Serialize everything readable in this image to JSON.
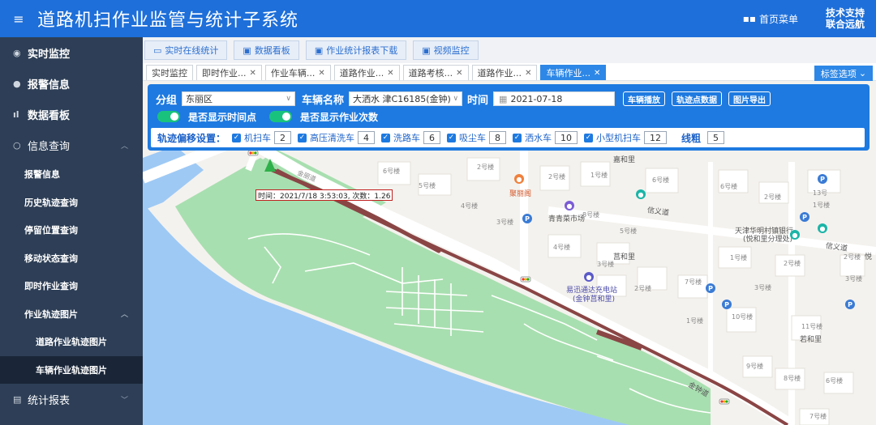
{
  "header": {
    "title": "道路机扫作业监管与统计子系统",
    "home_menu": "首页菜单",
    "support_line1": "技术支持",
    "support_line2": "联合远航"
  },
  "sidebar": {
    "items": [
      {
        "label": "实时监控",
        "icon": "location-icon"
      },
      {
        "label": "报警信息",
        "icon": "alarm-icon"
      },
      {
        "label": "数据看板",
        "icon": "bar-chart-icon"
      },
      {
        "label": "信息查询",
        "icon": "search-icon"
      }
    ],
    "sub_items": [
      "报警信息",
      "历史轨迹查询",
      "停留位置查询",
      "移动状态查询",
      "即时作业查询",
      "作业轨迹图片"
    ],
    "sub2_items": [
      "道路作业轨迹图片",
      "车辆作业轨迹图片"
    ],
    "last_item": "统计报表"
  },
  "buttons": {
    "realtime": "实时在线统计",
    "dashboard": "数据看板",
    "report_download": "作业统计报表下载",
    "video": "视频监控"
  },
  "tabs": {
    "items": [
      "实时监控",
      "即时作业...",
      "作业车辆...",
      "道路作业...",
      "道路考核...",
      "道路作业...",
      "车辆作业..."
    ],
    "active_index": 6,
    "options_label": "标签选项"
  },
  "filters": {
    "group_label": "分组",
    "group_value": "东丽区",
    "vehicle_label": "车辆名称",
    "vehicle_value": "大洒水 津C16185(金钟)",
    "time_label": "时间",
    "date_value": "2021-07-18",
    "btn_play": "车辆播放",
    "btn_track_data": "轨迹点数据",
    "btn_export": "图片导出",
    "toggle_time": "是否显示时间点",
    "toggle_count": "是否显示作业次数"
  },
  "offset": {
    "title": "轨迹偏移设置：",
    "items": [
      {
        "label": "机扫车",
        "value": "2"
      },
      {
        "label": "高压清洗车",
        "value": "4"
      },
      {
        "label": "洗路车",
        "value": "6"
      },
      {
        "label": "吸尘车",
        "value": "8"
      },
      {
        "label": "洒水车",
        "value": "10"
      },
      {
        "label": "小型机扫车",
        "value": "12"
      }
    ],
    "line_width_label": "线粗",
    "line_width_value": "5"
  },
  "map": {
    "tooltip": "时间：2021/7/18 3:53:03, 次数：1.26",
    "labels": {
      "road1": "金丽道",
      "road2": "信义道",
      "road3": "信义道",
      "road4": "金钟道",
      "b6": "6号楼",
      "b5": "5号楼",
      "b2a": "2号楼",
      "b4": "4号楼",
      "b3": "3号楼",
      "b2b": "2号楼",
      "b1": "1号楼",
      "b6b": "6号楼",
      "b5b": "5号楼",
      "b4b": "4号楼",
      "b3b": "3号楼",
      "b2c": "2号楼",
      "b7": "7号楼",
      "b1b": "1号楼",
      "b10": "10号楼",
      "b11": "11号楼",
      "b9": "9号楼",
      "b8": "8号楼",
      "b6c": "6号楼",
      "b7b": "7号楼",
      "b3c": "3号楼",
      "b2d": "2号楼",
      "b1c": "1号楼",
      "b13": "13号",
      "b2e": "2号楼",
      "b6d": "6号楼",
      "b1d": "1号楼",
      "b2f": "2号楼",
      "b3d": "3号楼",
      "b8b": "8号楼",
      "market": "青青菜市场",
      "restaurant": "聚丽阁",
      "community": "莒和里",
      "community2": "嘉和里",
      "community3": "若和里",
      "charging1": "易迅通达充电站",
      "charging2": "(金钟莒和里)",
      "bank1": "天津华明村镇银行",
      "bank2": "(悦和里分理处)",
      "yue": "悦"
    }
  }
}
